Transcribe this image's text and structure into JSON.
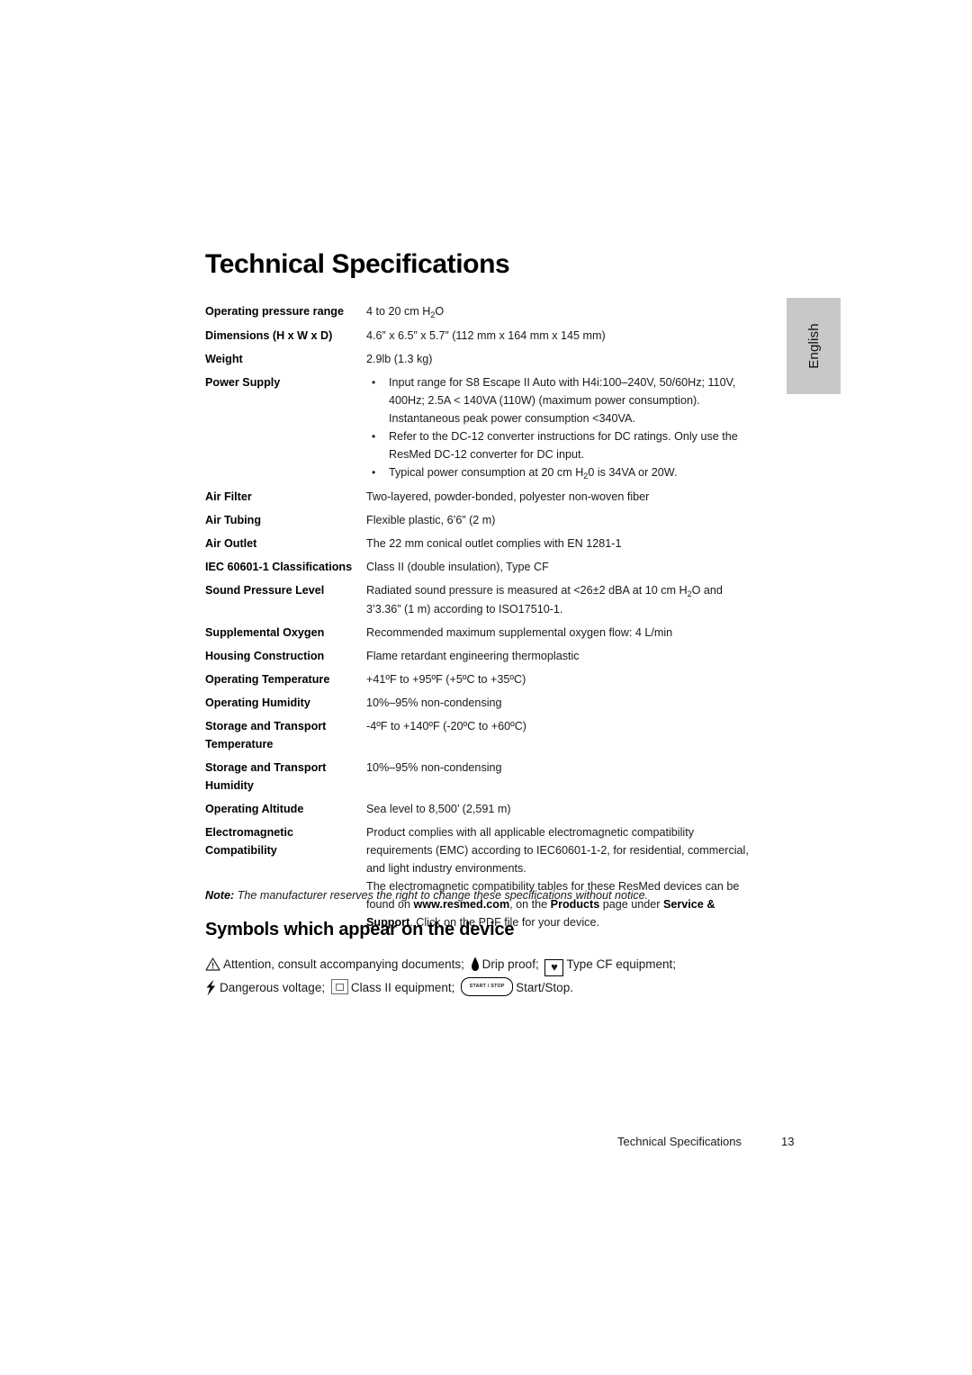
{
  "page": {
    "heading": "Technical Specifications",
    "language_tab": "English",
    "symbols_heading": "Symbols which appear on the device",
    "note_keyword": "Note:",
    "note_text": "The manufacturer reserves the right to change these specifications without notice.",
    "footer_title": "Technical Specifications",
    "footer_page": "13"
  },
  "specs": [
    {
      "label": "Operating pressure range",
      "lines": [
        "4 to 20 cm H₂O"
      ]
    },
    {
      "label": "Dimensions (H x W x D)",
      "lines": [
        "4.6” x 6.5” x 5.7” (112 mm x 164 mm x 145 mm)"
      ]
    },
    {
      "label": "Weight",
      "lines": [
        "2.9lb (1.3 kg)"
      ]
    },
    {
      "label": "Power Supply",
      "bullets": [
        "Input range for S8 Escape II Auto with H4i:100–240V, 50/60Hz; 110V, 400Hz; 2.5A < 140VA (110W) (maximum power consumption). Instantaneous peak power consumption <340VA.",
        "Refer to the DC-12 converter instructions for DC ratings. Only use the ResMed DC-12 converter for DC input.",
        "Typical power consumption at 20 cm H₂0 is 34VA or 20W."
      ]
    },
    {
      "label": "Air Filter",
      "lines": [
        "Two-layered, powder-bonded, polyester non-woven fiber"
      ]
    },
    {
      "label": "Air Tubing",
      "lines": [
        "Flexible plastic, 6’6” (2 m)"
      ]
    },
    {
      "label": "Air Outlet",
      "lines": [
        "The 22 mm conical outlet complies with EN 1281-1"
      ]
    },
    {
      "label": "IEC 60601-1 Classifications",
      "lines": [
        "Class II (double insulation), Type CF"
      ]
    },
    {
      "label": "Sound Pressure Level",
      "lines": [
        "Radiated sound pressure is measured at <26±2 dBA at 10 cm H₂O and 3’3.36” (1 m) according to ISO17510-1."
      ]
    },
    {
      "label": "Supplemental Oxygen",
      "lines": [
        "Recommended maximum supplemental oxygen flow: 4 L/min"
      ]
    },
    {
      "label": "Housing Construction",
      "lines": [
        "Flame retardant engineering thermoplastic"
      ]
    },
    {
      "label": "Operating Temperature",
      "lines": [
        "+41ºF to +95ºF (+5ºC to +35ºC)"
      ]
    },
    {
      "label": "Operating Humidity",
      "lines": [
        "10%–95% non-condensing"
      ]
    },
    {
      "label": "Storage and Transport Temperature",
      "lines": [
        "-4ºF to +140ºF (-20ºC to +60ºC)"
      ]
    },
    {
      "label": "Storage and Transport Humidity",
      "lines": [
        "10%–95% non-condensing"
      ]
    },
    {
      "label": "Operating Altitude",
      "lines": [
        "Sea level to 8,500’ (2,591 m)"
      ]
    }
  ],
  "emc": {
    "label": "Electromagnetic Compatibility",
    "paragraph1": "Product complies with all applicable electromagnetic compatibility requirements (EMC) according to IEC60601-1-2, for residential, commercial, and light industry environments.",
    "para2_part1": "The electromagnetic compatibility tables for these ResMed devices can be found on ",
    "para2_bold1": "www.resmed.com",
    "para2_part2": ", on the ",
    "para2_bold2": "Products",
    "para2_part3": " page under ",
    "para2_bold3": "Service & Support",
    "para2_part4": ". Click on the PDF file for your device."
  },
  "symbols": [
    {
      "icon": "warning-triangle-icon",
      "text": "Attention, consult accompanying documents;"
    },
    {
      "icon": "drip-proof-icon",
      "text": "Drip proof;"
    },
    {
      "icon": "type-cf-heart-icon",
      "text": "Type CF equipment;"
    },
    {
      "icon": "dangerous-voltage-icon",
      "text": "Dangerous voltage;"
    },
    {
      "icon": "class-ii-square-icon",
      "text": "Class II equipment;"
    },
    {
      "icon": "start-stop-button-icon",
      "text": "Start/Stop.",
      "icon_label": "START / STOP"
    }
  ]
}
